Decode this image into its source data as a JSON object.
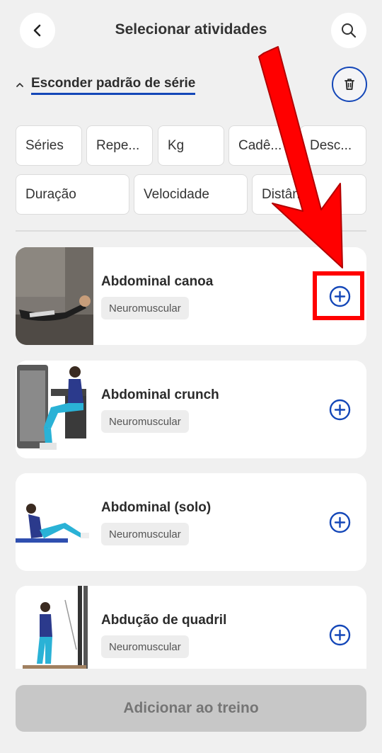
{
  "header": {
    "title": "Selecionar atividades",
    "back_icon": "chevron-left-icon",
    "search_icon": "search-icon"
  },
  "series_toggle": {
    "label": "Esconder padrão de série",
    "icon": "chevron-up-icon",
    "delete_icon": "trash-icon"
  },
  "fields": [
    {
      "label": "Séries"
    },
    {
      "label": "Repe..."
    },
    {
      "label": "Kg"
    },
    {
      "label": "Cadê..."
    },
    {
      "label": "Desc..."
    },
    {
      "label": "Duração"
    },
    {
      "label": "Velocidade"
    },
    {
      "label": "Distância"
    }
  ],
  "activities": [
    {
      "name": "Abdominal canoa",
      "tag": "Neuromuscular"
    },
    {
      "name": "Abdominal crunch",
      "tag": "Neuromuscular"
    },
    {
      "name": "Abdominal (solo)",
      "tag": "Neuromuscular"
    },
    {
      "name": "Abdução de quadril",
      "tag": "Neuromuscular"
    }
  ],
  "footer": {
    "add_button_label": "Adicionar ao treino"
  },
  "colors": {
    "accent": "#1447b8",
    "annotation": "#ff0000",
    "background": "#f0f0f0"
  }
}
